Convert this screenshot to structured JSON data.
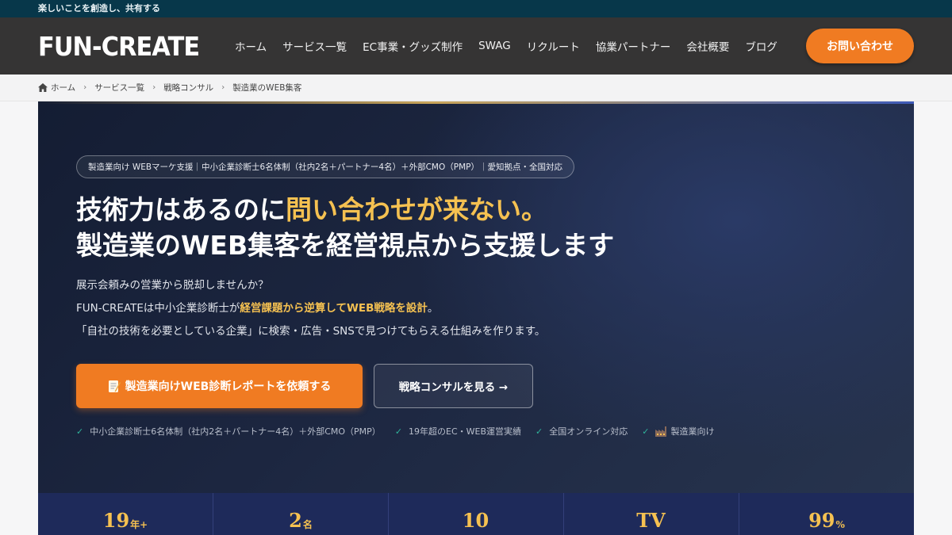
{
  "topbar": {
    "tagline": "楽しいことを創造し、共有する"
  },
  "header": {
    "logo": "FUN-CREATE",
    "nav": [
      "ホーム",
      "サービス一覧",
      "EC事業・グッズ制作",
      "SWAG",
      "リクルート",
      "協業パートナー",
      "会社概要",
      "ブログ"
    ],
    "contact_label": "お問い合わせ",
    "accent_color": "#f07b22"
  },
  "breadcrumb": [
    "ホーム",
    "サービス一覧",
    "戦略コンサル",
    "製造業のWEB集客"
  ],
  "hero": {
    "badge": "製造業向け WEBマーケ支援｜中小企業診断士6名体制（社内2名＋パートナー4名）＋外部CMO（PMP）｜愛知拠点・全国対応",
    "headline_line1_pre": "技術力はあるのに",
    "headline_line1_highlight": "問い合わせが来ない。",
    "headline_line2": "製造業のWEB集客を経営視点から支援します",
    "desc_line1": "展示会頼みの営業から脱却しませんか？",
    "desc_line2_pre": "FUN-CREATEは中小企業診断士が",
    "desc_line2_highlight": "経営課題から逆算してWEB戦略を設計",
    "desc_line2_post": "。",
    "desc_line3": "「自社の技術を必要としている企業」に検索・広告・SNSで見つけてもらえる仕組みを作ります。",
    "cta_primary": "製造業向けWEB診断レポートを依頼する",
    "cta_secondary": "戦略コンサルを見る →",
    "checks": [
      "中小企業診断士6名体制（社内2名＋パートナー4名）＋外部CMO（PMP）",
      "19年超のEC・WEB運営実績",
      "全国オンライン対応",
      "製造業向け"
    ],
    "highlight_color": "#f5c151"
  },
  "stats": [
    {
      "num": "19",
      "unit": "年+"
    },
    {
      "num": "2",
      "unit": "名"
    },
    {
      "num": "10",
      "unit": ""
    },
    {
      "num": "TV",
      "unit": ""
    },
    {
      "num": "99",
      "unit": "%"
    }
  ]
}
